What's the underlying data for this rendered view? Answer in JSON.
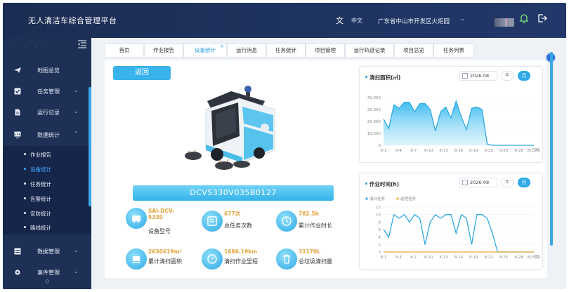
{
  "app": {
    "title": "无人清洁车综合管理平台"
  },
  "header": {
    "lang_label": "中文",
    "region": "广东省中山市开发区火炬园"
  },
  "sidebar": {
    "items": [
      {
        "label": "地图总览",
        "icon": "paper-plane-icon"
      },
      {
        "label": "任务管理",
        "icon": "checkbox-icon"
      },
      {
        "label": "运行记录",
        "icon": "document-icon"
      },
      {
        "label": "数据统计",
        "icon": "monitor-chart-icon"
      },
      {
        "label": "数据管理",
        "icon": "database-icon"
      },
      {
        "label": "事件管理",
        "icon": "gear-icon"
      }
    ],
    "sub_items": [
      {
        "label": "作业报告"
      },
      {
        "label": "设备统计",
        "active": true
      },
      {
        "label": "任务统计"
      },
      {
        "label": "告警统计"
      },
      {
        "label": "安防统计"
      },
      {
        "label": "路线统计"
      }
    ]
  },
  "tabs": [
    {
      "label": "首页"
    },
    {
      "label": "作业报告"
    },
    {
      "label": "设备统计",
      "active": true,
      "close": "×"
    },
    {
      "label": "运行消息"
    },
    {
      "label": "任务统计"
    },
    {
      "label": "项目管理"
    },
    {
      "label": "运行轨迹记录"
    },
    {
      "label": "项目总览"
    },
    {
      "label": "任务列表"
    }
  ],
  "main": {
    "back_label": "返回",
    "plate": "DCVS330V035B0127",
    "stats": [
      {
        "value": "SAI-DCV-5330",
        "label": "设备型号",
        "icon": "vehicle-icon"
      },
      {
        "value": "677次",
        "label": "总任务次数",
        "icon": "list-icon"
      },
      {
        "value": "782.5h",
        "label": "累计作业时长",
        "icon": "clock-icon"
      },
      {
        "value": "2630619m²",
        "label": "累计清扫面积",
        "icon": "sweeper-icon"
      },
      {
        "value": "1686.19km",
        "label": "清扫作业里程",
        "icon": "speedometer-icon"
      },
      {
        "value": "31170L",
        "label": "总垃圾清扫量",
        "icon": "trash-icon"
      }
    ]
  },
  "cards": [
    {
      "title": "清扫面积(㎡)",
      "date": "2026-08",
      "switch_label": "年",
      "month_label": "月"
    },
    {
      "title": "作业时间(h)",
      "date": "2026-08",
      "switch_label": "年",
      "month_label": "月"
    }
  ],
  "colors": {
    "accent": "#2fa9e6",
    "sidebar": "#1e3056",
    "topbar": "#1b2d53",
    "orange": "#f0a93b"
  },
  "chart_data": [
    {
      "type": "area",
      "title": "清扫面积(㎡)",
      "x": [
        "8-1",
        "8-2",
        "8-3",
        "8-4",
        "8-5",
        "8-6",
        "8-7",
        "8-8",
        "8-9",
        "8-10",
        "8-11",
        "8-12",
        "8-13",
        "8-14",
        "8-15",
        "8-16",
        "8-17",
        "8-18",
        "8-19",
        "8-20",
        "8-21",
        "8-22",
        "8-23",
        "8-24",
        "8-25",
        "8-26",
        "8-27",
        "8-28",
        "8-29",
        "8-30"
      ],
      "x_tick_labels": [
        "8-1",
        "8-4",
        "8-7",
        "8-10",
        "8-13",
        "8-16",
        "8-19",
        "8-22",
        "8-25",
        "8-28",
        "8(日期)"
      ],
      "y_ticks": [
        "40,000",
        "30,000",
        "20,000",
        "10,000",
        "0"
      ],
      "ylim": [
        0,
        40000
      ],
      "series": [
        {
          "values": [
            22000,
            14000,
            34000,
            31000,
            36000,
            36000,
            28000,
            35000,
            35000,
            30000,
            12000,
            28000,
            32000,
            23000,
            37000,
            24000,
            13000,
            31000,
            32000,
            30000,
            1000,
            0,
            0,
            0,
            0,
            0,
            0,
            0,
            0,
            0
          ]
        }
      ]
    },
    {
      "type": "line",
      "title": "作业时间(h)",
      "x": [
        "8-1",
        "8-2",
        "8-3",
        "8-4",
        "8-5",
        "8-6",
        "8-7",
        "8-8",
        "8-9",
        "8-10",
        "8-11",
        "8-12",
        "8-13",
        "8-14",
        "8-15",
        "8-16",
        "8-17",
        "8-18",
        "8-19",
        "8-20",
        "8-21",
        "8-22",
        "8-23",
        "8-24",
        "8-25",
        "8-26",
        "8-27",
        "8-28",
        "8-29",
        "8-30"
      ],
      "x_tick_labels": [
        "8-1",
        "8-4",
        "8-7",
        "8-10",
        "8-13",
        "8-16",
        "8-19",
        "8-22",
        "8-25",
        "8-28",
        "8(日期)"
      ],
      "y_ticks": [
        "12",
        "10",
        "8",
        "6",
        "4",
        "2",
        "0"
      ],
      "ylim": [
        0,
        12
      ],
      "legend": [
        "清扫任务",
        "巡逻任务"
      ],
      "series": [
        {
          "name": "清扫任务",
          "color": "#2fa9e6",
          "values": [
            6,
            4,
            10,
            9,
            10,
            8,
            10,
            9,
            2,
            8,
            10,
            9,
            10,
            10,
            5,
            10,
            9,
            2,
            10,
            10,
            9,
            5,
            0,
            0,
            0,
            0,
            0,
            0,
            0,
            0
          ]
        },
        {
          "name": "巡逻任务",
          "color": "#f0a93b",
          "values": [
            0,
            0,
            0,
            0,
            0,
            0,
            0,
            0,
            0,
            0,
            0,
            0,
            0,
            0,
            0,
            0,
            0,
            0,
            0,
            0,
            0,
            0,
            0,
            0,
            0,
            0,
            0,
            0,
            0,
            0
          ]
        }
      ]
    }
  ]
}
